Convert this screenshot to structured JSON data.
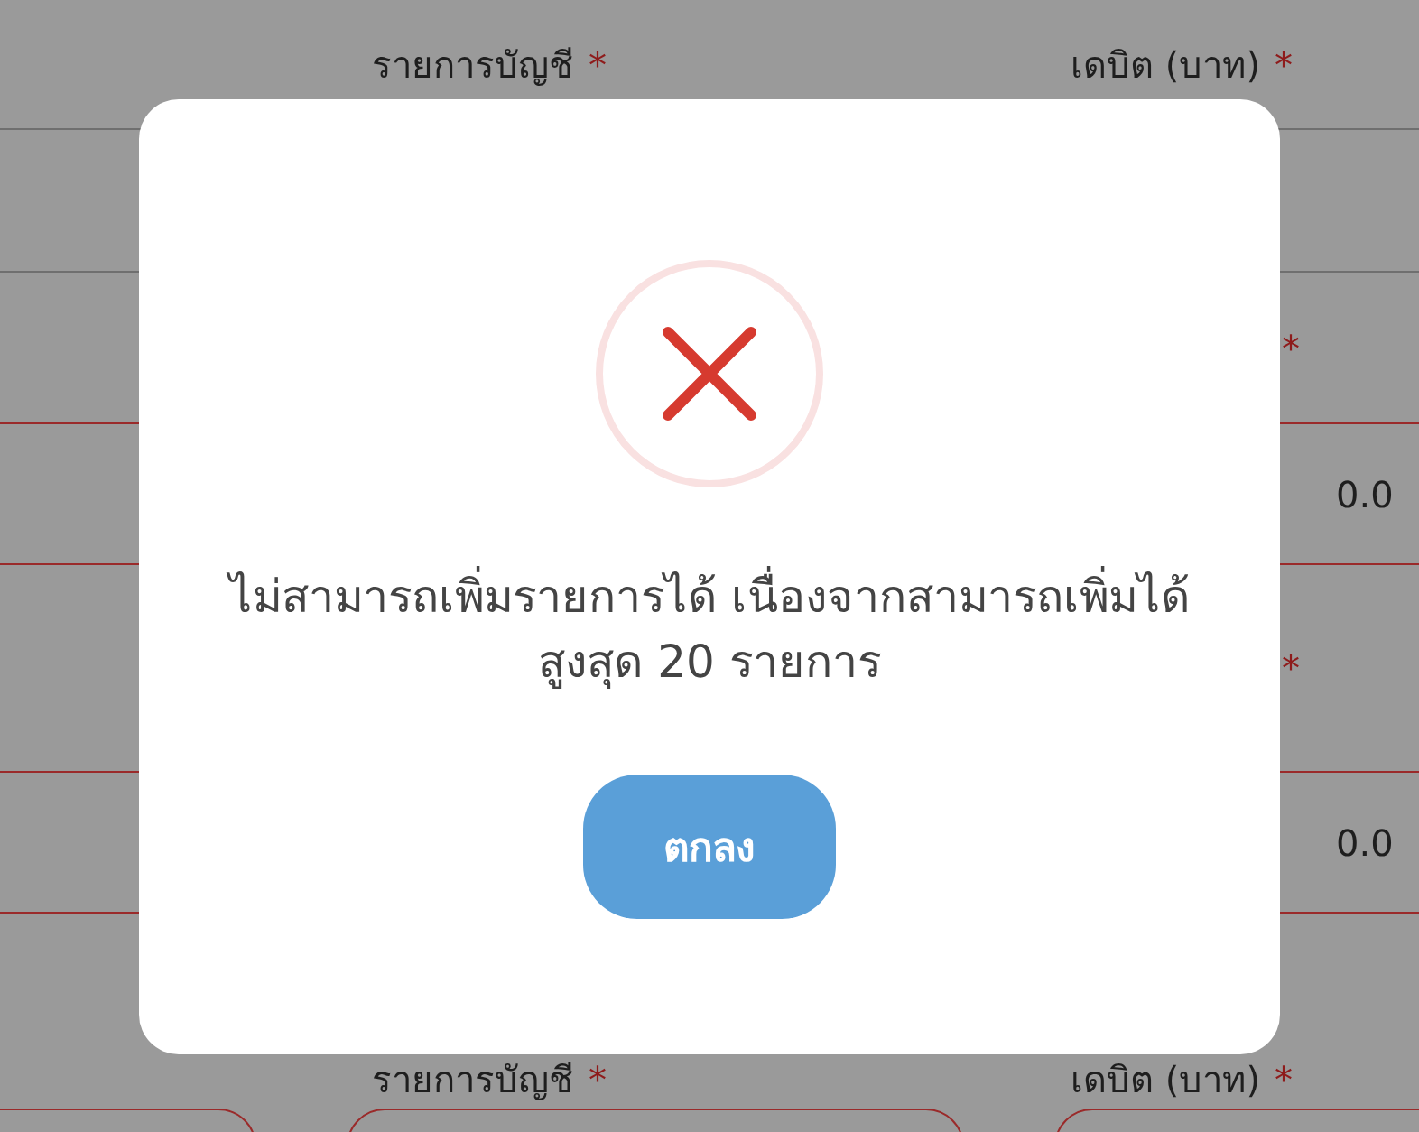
{
  "background_form": {
    "rows": [
      {
        "kind": "labels",
        "account_label": "รายการบัญชี",
        "account_required": "*",
        "debit_label": "เดบิต (บาท)",
        "debit_required": "*"
      },
      {
        "kind": "blank"
      },
      {
        "kind": "required_mark",
        "mark": "*"
      },
      {
        "kind": "amount",
        "value": "0.0"
      },
      {
        "kind": "required_mark",
        "mark": "*"
      },
      {
        "kind": "amount",
        "value": "0.0"
      },
      {
        "kind": "labels",
        "account_label": "รายการบัญชี",
        "account_required": "*",
        "debit_label": "เดบิต (บาท)",
        "debit_required": "*"
      },
      {
        "kind": "fields"
      }
    ]
  },
  "dialog": {
    "message": "ไม่สามารถเพิ่มรายการได้ เนื่องจากสามารถเพิ่มได้สูงสุด 20 รายการ",
    "button": "ตกลง"
  }
}
